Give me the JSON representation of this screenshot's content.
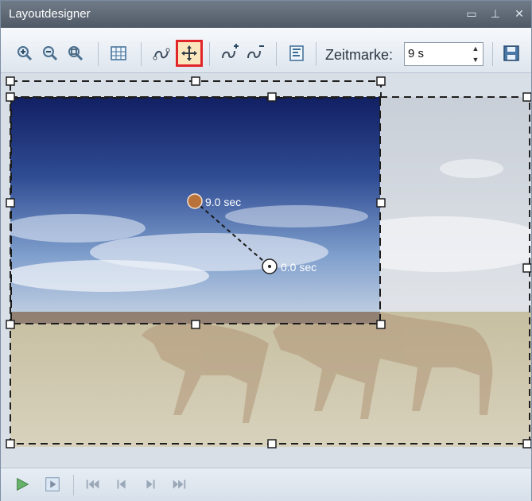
{
  "window": {
    "title": "Layoutdesigner",
    "title_buttons": [
      "minimize-icon",
      "pin-icon",
      "close-icon"
    ]
  },
  "toolbar": {
    "icons": [
      "zoom-in-icon",
      "zoom-out-icon",
      "zoom-fit-icon",
      "grid-icon",
      "motion-path-icon",
      "move-anchor-icon",
      "add-keyframe-icon",
      "remove-keyframe-icon",
      "align-icon"
    ],
    "active_tool": "move-anchor-icon",
    "zeitmarke_label": "Zeitmarke:",
    "zeitmarke_value": "9 s",
    "save_icon": "save-icon"
  },
  "canvas": {
    "keyframes": [
      {
        "label": "9.0 sec",
        "color": "#b9723a"
      },
      {
        "label": "0.0 sec",
        "color": "#ffffff"
      }
    ]
  },
  "playback": {
    "buttons": [
      "play-icon",
      "play-frame-icon",
      "skip-start-icon",
      "prev-frame-icon",
      "next-frame-icon",
      "skip-end-icon"
    ]
  },
  "colors": {
    "active_outline": "#e0262a",
    "accent": "#4aa35d"
  }
}
